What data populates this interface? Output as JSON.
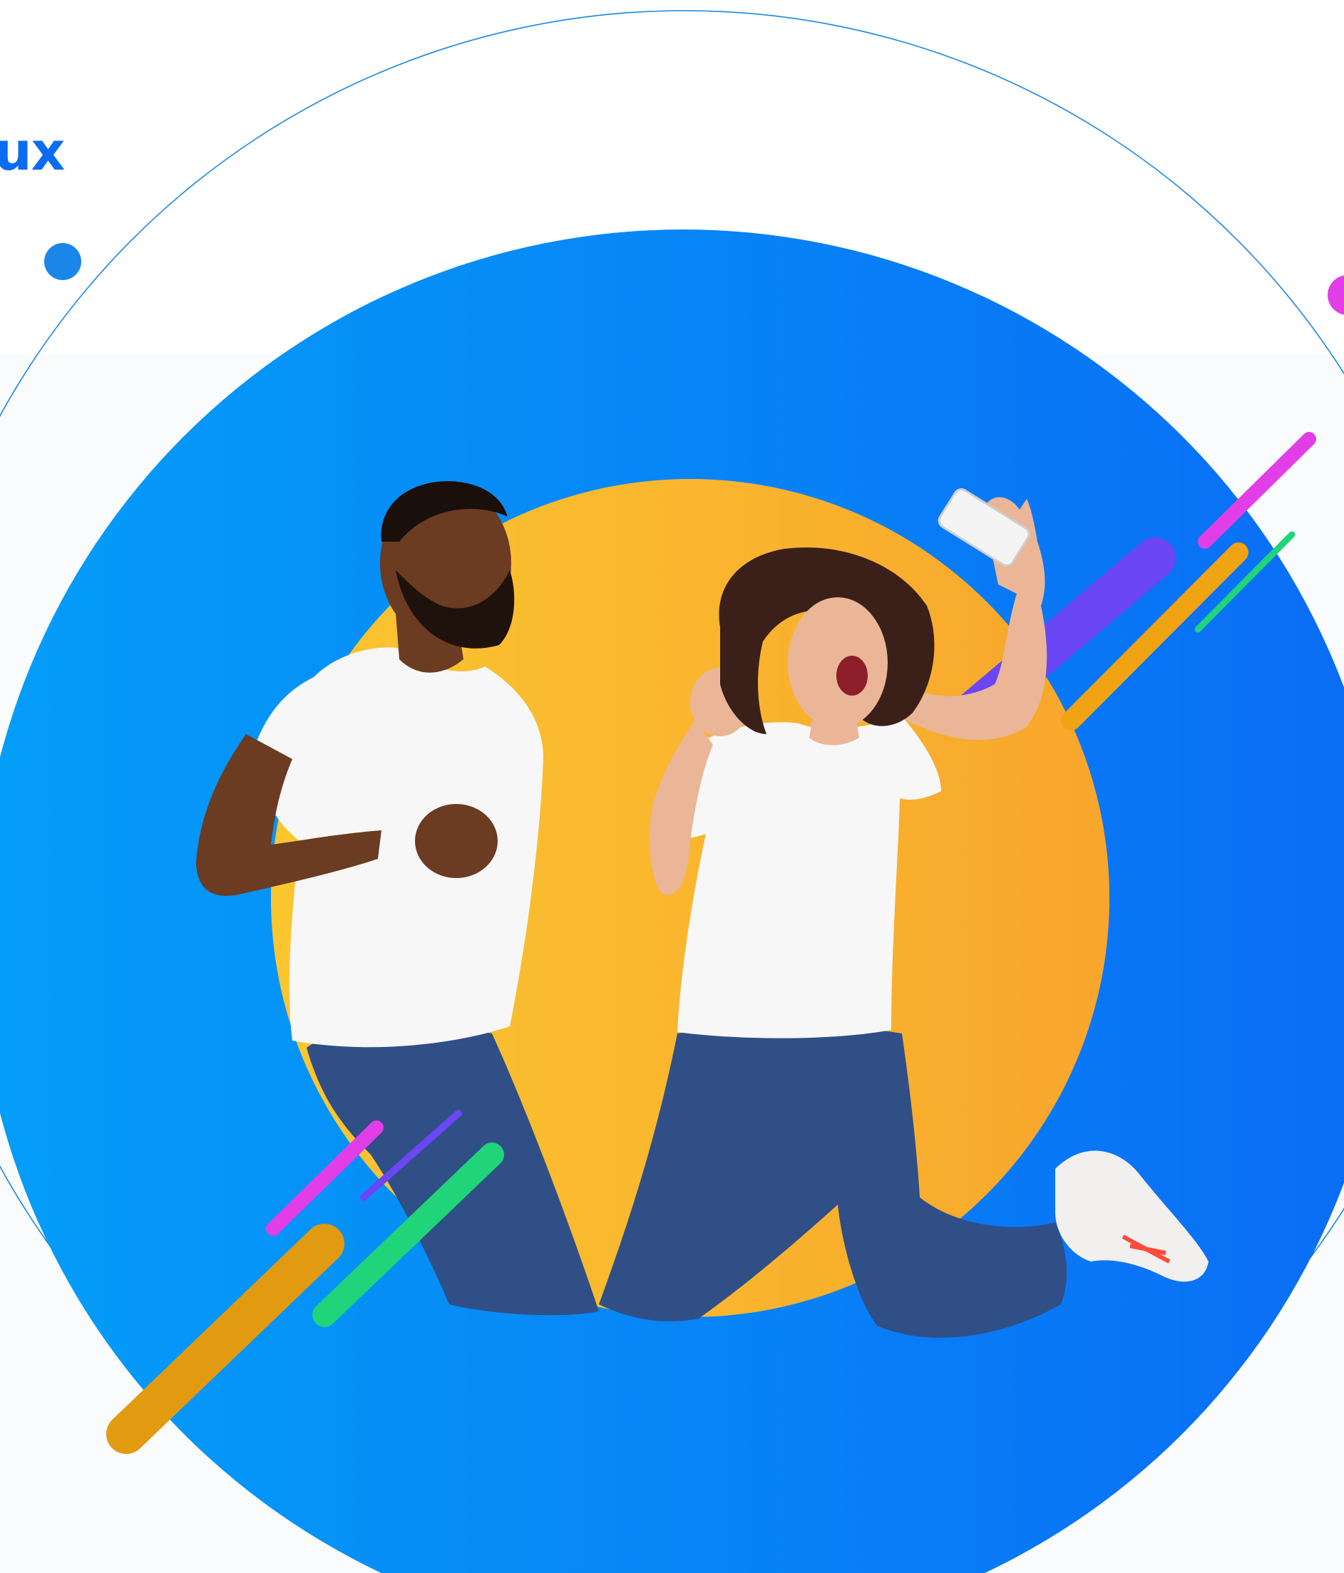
{
  "header": {
    "brand_fragment": "ux"
  },
  "colors": {
    "outer_ring": "#1a86e8",
    "blue_disc_left": "#049ef8",
    "blue_disc_right": "#0a6cf5",
    "yellow_disc_left": "#fbc630",
    "yellow_disc_right": "#f8a62c",
    "accent_magenta": "#e23ee8",
    "accent_violet": "#6a46f4",
    "accent_gold": "#f0a313",
    "accent_green": "#20d47a",
    "accent_dark_gold": "#e29b10",
    "shirt_white": "#f7f7f7",
    "denim_blue": "#2f4f86",
    "skin_dark": "#6b3b22",
    "skin_light": "#eab697",
    "hair_brown": "#3a2018"
  },
  "icons": {
    "accent_dot_blue": "blue-dot-icon",
    "accent_dot_magenta": "magenta-dot-icon"
  }
}
